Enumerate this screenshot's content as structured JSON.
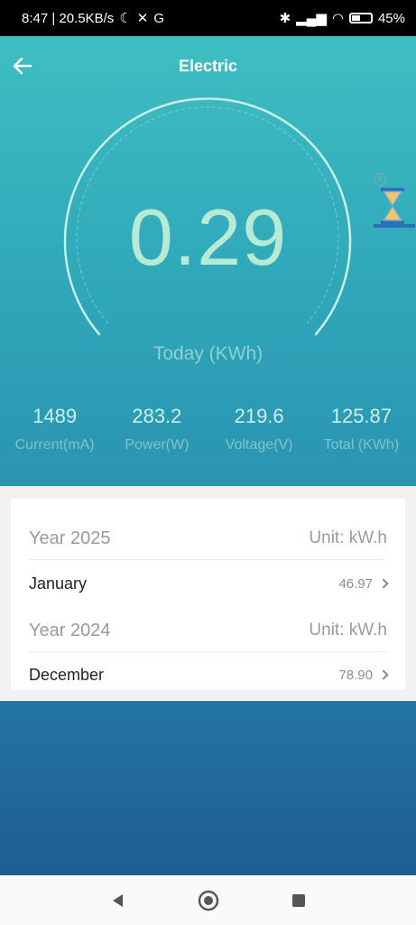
{
  "status": {
    "time_speed": "8:47 | 20.5KB/s",
    "battery": "45%"
  },
  "header": {
    "title": "Electric"
  },
  "gauge": {
    "value": "0.29",
    "label": "Today (KWh)"
  },
  "stats": [
    {
      "value": "1489",
      "label": "Current(mA)"
    },
    {
      "value": "283.2",
      "label": "Power(W)"
    },
    {
      "value": "219.6",
      "label": "Voltage(V)"
    },
    {
      "value": "125.87",
      "label": "Total (KWh)"
    }
  ],
  "history": [
    {
      "year": "Year 2025",
      "unit": "Unit: kW.h",
      "month": "January",
      "value": "46.97"
    },
    {
      "year": "Year 2024",
      "unit": "Unit: kW.h",
      "month": "December",
      "value": "78.90"
    }
  ],
  "icons": {
    "back": "back-arrow-icon",
    "hourglass": "hourglass-icon",
    "nav_back": "triangle-back-icon",
    "nav_home": "circle-home-icon",
    "nav_recent": "square-recent-icon"
  },
  "colors": {
    "accent_top": "#3fbec2",
    "accent_bottom": "#1e5d95",
    "gauge_value": "#b7ead5"
  }
}
